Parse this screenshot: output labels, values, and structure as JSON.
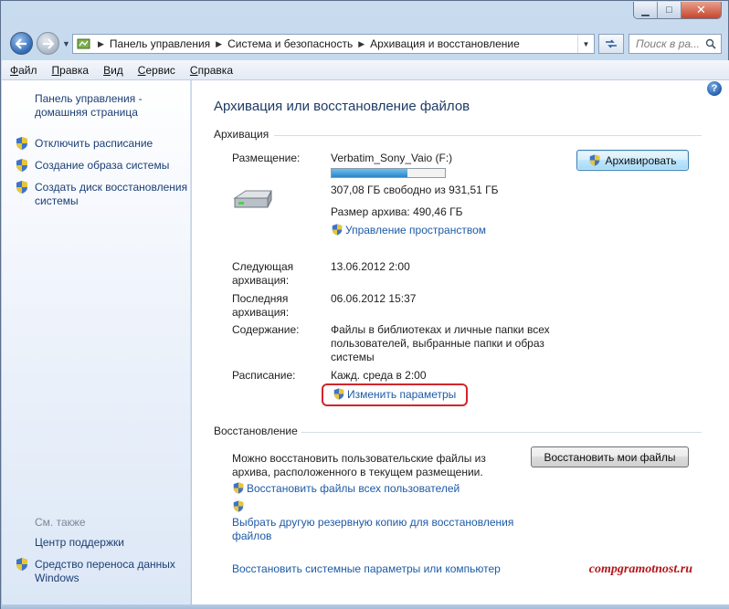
{
  "window": {
    "controls": {
      "minimize": "▁",
      "maximize": "□",
      "close": "✕"
    }
  },
  "nav": {
    "breadcrumbs": [
      "Панель управления",
      "Система и безопасность",
      "Архивация и восстановление"
    ],
    "search_placeholder": "Поиск в ра...",
    "icons": {
      "back": "back-arrow-icon",
      "forward": "forward-arrow-icon",
      "refresh": "refresh-icon",
      "search": "magnifier-icon"
    }
  },
  "menu": {
    "items": [
      {
        "label": "Файл",
        "key": "Ф",
        "rest": "айл"
      },
      {
        "label": "Правка",
        "key": "П",
        "rest": "равка"
      },
      {
        "label": "Вид",
        "key": "В",
        "rest": "ид"
      },
      {
        "label": "Сервис",
        "key": "С",
        "rest": "ервис"
      },
      {
        "label": "Справка",
        "key": "С",
        "rest": "правка"
      }
    ]
  },
  "sidebar": {
    "home_line1": "Панель управления -",
    "home_line2": "домашняя страница",
    "items": [
      {
        "label": "Отключить расписание",
        "icon": "uac-shield-icon"
      },
      {
        "label": "Создание образа системы",
        "icon": "uac-shield-icon"
      },
      {
        "label_line1": "Создать диск восстановления",
        "label_line2": "системы",
        "icon": "uac-shield-icon"
      }
    ],
    "see_also": "См. также",
    "bottom_items": [
      {
        "label": "Центр поддержки"
      },
      {
        "label_line1": "Средство переноса данных",
        "label_line2": "Windows",
        "icon": "uac-shield-icon"
      }
    ]
  },
  "main": {
    "title": "Архивация или восстановление файлов",
    "backup_section": "Архивация",
    "location_label": "Размещение:",
    "location_value": "Verbatim_Sony_Vaio (F:)",
    "free_space": "307,08 ГБ свободно из 931,51 ГБ",
    "drive_used_fraction": 0.67,
    "archive_size": "Размер архива: 490,46 ГБ",
    "manage_space_link": "Управление пространством",
    "backup_button": "Архивировать",
    "next_backup_label_line1": "Следующая",
    "next_backup_label_line2": "архивация:",
    "next_backup_value": "13.06.2012 2:00",
    "last_backup_label_line1": "Последняя",
    "last_backup_label_line2": "архивация:",
    "last_backup_value": "06.06.2012 15:37",
    "contents_label": "Содержание:",
    "contents_line1": "Файлы в библиотеках и личные папки всех",
    "contents_line2": "пользователей, выбранные папки и образ",
    "contents_line3": "системы",
    "schedule_label": "Расписание:",
    "schedule_value": "Кажд. среда в 2:00",
    "change_settings_link": "Изменить параметры",
    "restore_section": "Восстановление",
    "restore_text_line1": "Можно восстановить пользовательские файлы из",
    "restore_text_line2": "архива, расположенного в текущем размещении.",
    "restore_button": "Восстановить мои файлы",
    "restore_all_users_link": "Восстановить файлы всех пользователей",
    "choose_other_line1": "Выбрать другую резервную копию для восстановления",
    "choose_other_line2": "файлов",
    "restore_system_link": "Восстановить системные параметры или компьютер",
    "help_icon": "?",
    "watermark": "compgramotnost.ru"
  }
}
